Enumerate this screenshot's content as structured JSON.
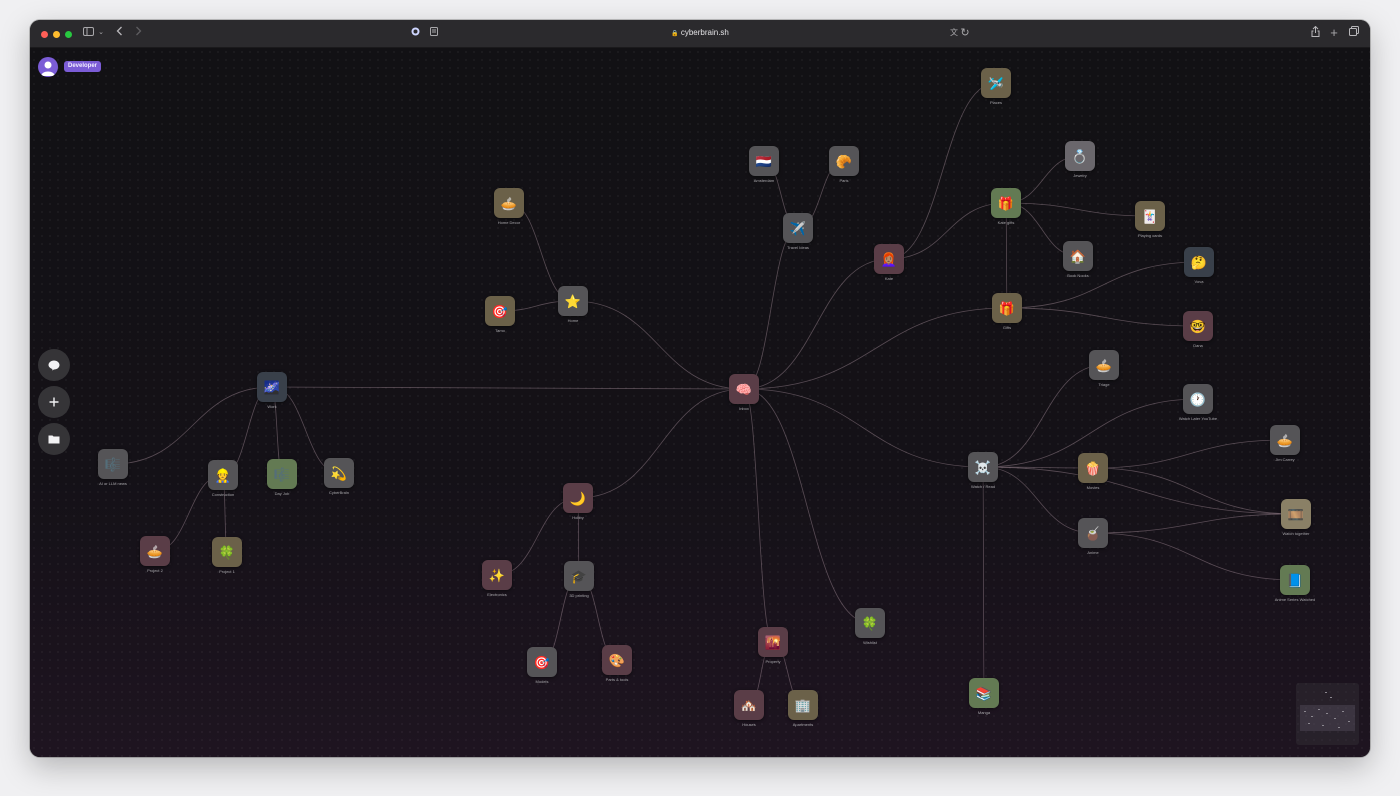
{
  "browser": {
    "url": "cyberbrain.sh"
  },
  "user": {
    "role_badge": "Developer"
  },
  "sidebar": {
    "buttons": [
      {
        "name": "chat-button",
        "icon": "chat-bubble-icon"
      },
      {
        "name": "add-node-button",
        "icon": "plus-icon"
      },
      {
        "name": "folder-button",
        "icon": "folder-icon"
      }
    ]
  },
  "graph": {
    "nodes": [
      {
        "id": "places",
        "label": "Places",
        "icon": "🛩️",
        "color": "#6b6149"
      },
      {
        "id": "amsterdam",
        "label": "Amsterdam",
        "icon": "🇳🇱",
        "color": "#555457"
      },
      {
        "id": "paris",
        "label": "Paris",
        "icon": "🥐",
        "color": "#555457"
      },
      {
        "id": "home_decor",
        "label": "Home Decor",
        "icon": "🥧",
        "color": "#6b6149"
      },
      {
        "id": "travel_ideas",
        "label": "Travel Ideas",
        "icon": "✈️",
        "color": "#555457"
      },
      {
        "id": "kate",
        "label": "Kate",
        "icon": "👩🏽‍🦰",
        "color": "#5a3d47"
      },
      {
        "id": "kate_gifts",
        "label": "Kate gifts",
        "icon": "🎁",
        "color": "#637a53"
      },
      {
        "id": "jewelry",
        "label": "Jewelry",
        "icon": "💍",
        "color": "#6a676c"
      },
      {
        "id": "playing_cards",
        "label": "Playing cards",
        "icon": "🃏",
        "color": "#6b6149"
      },
      {
        "id": "book_nooks",
        "label": "Book Nooks",
        "icon": "🏠",
        "color": "#555457"
      },
      {
        "id": "vova",
        "label": "Vova",
        "icon": "🤔",
        "color": "#39404a"
      },
      {
        "id": "home",
        "label": "Home",
        "icon": "⭐",
        "color": "#555457"
      },
      {
        "id": "tamo",
        "label": "Tamo",
        "icon": "🎯",
        "color": "#6b6149"
      },
      {
        "id": "gifts",
        "label": "Gifts",
        "icon": "🎁",
        "color": "#6b6149"
      },
      {
        "id": "dana",
        "label": "Dana",
        "icon": "🤓",
        "color": "#5a3d47"
      },
      {
        "id": "triage",
        "label": "Triage",
        "icon": "🥧",
        "color": "#555457"
      },
      {
        "id": "inbox",
        "label": "Inbox",
        "icon": "🧠",
        "color": "#5a3d47"
      },
      {
        "id": "work",
        "label": "Work",
        "icon": "🌌",
        "color": "#39404a"
      },
      {
        "id": "watch_later",
        "label": "Watch Later YouTube",
        "icon": "🕐",
        "color": "#555457"
      },
      {
        "id": "jim_carrey",
        "label": "Jim Carrey",
        "icon": "🥧",
        "color": "#555457"
      },
      {
        "id": "ai_news",
        "label": "AI or LLM news",
        "icon": "🎼",
        "color": "#555457"
      },
      {
        "id": "watch_read",
        "label": "Watch / Read",
        "icon": "☠️",
        "color": "#555457"
      },
      {
        "id": "movies",
        "label": "Movies",
        "icon": "🍿",
        "color": "#6b6149"
      },
      {
        "id": "construction",
        "label": "Construction",
        "icon": "👷",
        "color": "#555457"
      },
      {
        "id": "day_job",
        "label": "Day Job",
        "icon": "🎼",
        "color": "#637a53"
      },
      {
        "id": "cyberbrain",
        "label": "CyberBrain",
        "icon": "💫",
        "color": "#555457"
      },
      {
        "id": "hobby",
        "label": "Hobby",
        "icon": "🌙",
        "color": "#5a3d47"
      },
      {
        "id": "watch_together",
        "label": "Watch together",
        "icon": "🎞️",
        "color": "#8a8066"
      },
      {
        "id": "anime",
        "label": "Anime",
        "icon": "🧉",
        "color": "#555457"
      },
      {
        "id": "project2",
        "label": "Project 2",
        "icon": "🥧",
        "color": "#5a3d47"
      },
      {
        "id": "project1",
        "label": "Project 1",
        "icon": "🍀",
        "color": "#6b6149"
      },
      {
        "id": "electronics",
        "label": "Electronics",
        "icon": "✨",
        "color": "#5a3d47"
      },
      {
        "id": "printing",
        "label": "3D printing",
        "icon": "🎓",
        "color": "#555457"
      },
      {
        "id": "anime_series",
        "label": "Anime Series Watched",
        "icon": "📘",
        "color": "#637a53"
      },
      {
        "id": "wishlist",
        "label": "Wishlist",
        "icon": "🍀",
        "color": "#555457"
      },
      {
        "id": "property",
        "label": "Property",
        "icon": "🌇",
        "color": "#5a3d47"
      },
      {
        "id": "models",
        "label": "Models",
        "icon": "🎯",
        "color": "#555457"
      },
      {
        "id": "parts_tools",
        "label": "Parts & tools",
        "icon": "🎨",
        "color": "#5a3d47"
      },
      {
        "id": "manga",
        "label": "Manga",
        "icon": "📚",
        "color": "#637a53"
      },
      {
        "id": "houses",
        "label": "Houses",
        "icon": "🏘️",
        "color": "#5a3d47"
      },
      {
        "id": "apartments",
        "label": "Apartments",
        "icon": "🏢",
        "color": "#6b6149"
      }
    ],
    "edges": [
      [
        "inbox",
        "travel_ideas"
      ],
      [
        "travel_ideas",
        "amsterdam"
      ],
      [
        "travel_ideas",
        "paris"
      ],
      [
        "inbox",
        "kate"
      ],
      [
        "kate",
        "places"
      ],
      [
        "kate",
        "kate_gifts"
      ],
      [
        "kate_gifts",
        "jewelry"
      ],
      [
        "kate_gifts",
        "playing_cards"
      ],
      [
        "kate_gifts",
        "book_nooks"
      ],
      [
        "kate_gifts",
        "gifts"
      ],
      [
        "inbox",
        "gifts"
      ],
      [
        "gifts",
        "vova"
      ],
      [
        "gifts",
        "dana"
      ],
      [
        "inbox",
        "home"
      ],
      [
        "home",
        "home_decor"
      ],
      [
        "home",
        "tamo"
      ],
      [
        "inbox",
        "work"
      ],
      [
        "work",
        "ai_news"
      ],
      [
        "work",
        "construction"
      ],
      [
        "work",
        "day_job"
      ],
      [
        "work",
        "cyberbrain"
      ],
      [
        "construction",
        "project2"
      ],
      [
        "construction",
        "project1"
      ],
      [
        "inbox",
        "hobby"
      ],
      [
        "hobby",
        "electronics"
      ],
      [
        "hobby",
        "printing"
      ],
      [
        "printing",
        "models"
      ],
      [
        "printing",
        "parts_tools"
      ],
      [
        "inbox",
        "property"
      ],
      [
        "property",
        "houses"
      ],
      [
        "property",
        "apartments"
      ],
      [
        "inbox",
        "wishlist"
      ],
      [
        "inbox",
        "watch_read"
      ],
      [
        "watch_read",
        "triage"
      ],
      [
        "watch_read",
        "watch_later"
      ],
      [
        "watch_read",
        "movies"
      ],
      [
        "watch_read",
        "anime"
      ],
      [
        "watch_read",
        "manga"
      ],
      [
        "movies",
        "jim_carrey"
      ],
      [
        "movies",
        "watch_together"
      ],
      [
        "anime",
        "watch_together"
      ],
      [
        "anime",
        "anime_series"
      ],
      [
        "watch_read",
        "watch_together"
      ]
    ]
  }
}
